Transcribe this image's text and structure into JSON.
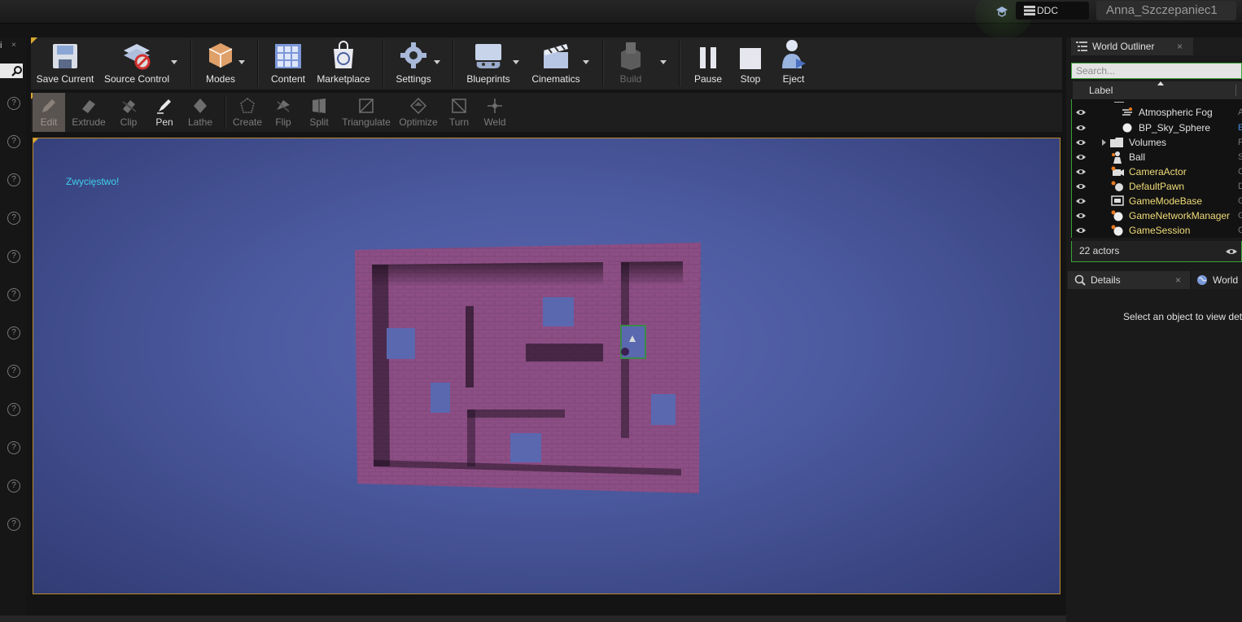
{
  "titlebar": {
    "ddc_label": "DDC",
    "user_name": "Anna_Szczepaniec1"
  },
  "left_strip": {
    "tab_label": "i",
    "close": "×"
  },
  "main_toolbar": {
    "buttons": [
      {
        "label": "Save Current",
        "icon": "save-icon"
      },
      {
        "label": "Source Control",
        "icon": "source-control-icon"
      },
      {
        "label": "Modes",
        "icon": "modes-icon"
      },
      {
        "label": "Content",
        "icon": "content-icon"
      },
      {
        "label": "Marketplace",
        "icon": "marketplace-icon"
      },
      {
        "label": "Settings",
        "icon": "settings-icon"
      },
      {
        "label": "Blueprints",
        "icon": "blueprints-icon"
      },
      {
        "label": "Cinematics",
        "icon": "cinematics-icon"
      },
      {
        "label": "Build",
        "icon": "build-icon"
      },
      {
        "label": "Pause",
        "icon": "pause-icon"
      },
      {
        "label": "Stop",
        "icon": "stop-icon"
      },
      {
        "label": "Eject",
        "icon": "eject-icon"
      }
    ]
  },
  "geometry_toolbar": {
    "tools": [
      "Edit",
      "Extrude",
      "Clip",
      "Pen",
      "Lathe",
      "Create",
      "Flip",
      "Split",
      "Triangulate",
      "Optimize",
      "Turn",
      "Weld"
    ]
  },
  "viewport": {
    "overlay_text": "Zwycięstwo!"
  },
  "world_outliner": {
    "title": "World Outliner",
    "close": "×",
    "search_placeholder": "Search...",
    "column_label": "Label",
    "rows": [
      {
        "name": "Atmospheric Fog",
        "type": "A"
      },
      {
        "name": "BP_Sky_Sphere",
        "type": "E"
      },
      {
        "name": "Volumes",
        "type": "F"
      },
      {
        "name": "Ball",
        "type": "S"
      },
      {
        "name": "CameraActor",
        "type": "C"
      },
      {
        "name": "DefaultPawn",
        "type": "D"
      },
      {
        "name": "GameModeBase",
        "type": "G"
      },
      {
        "name": "GameNetworkManager",
        "type": "G"
      },
      {
        "name": "GameSession",
        "type": "G"
      }
    ],
    "actor_count": "22 actors"
  },
  "details": {
    "tab_label": "Details",
    "close": "×",
    "world_tab_label": "World",
    "empty_message": "Select an object to view det"
  },
  "colors": {
    "viewport_bg": "#4c5aa0",
    "maze": "#8c4e85",
    "accent_green": "#3aa23a",
    "viewport_border": "#b88a2c",
    "victory_text": "#3fd0ee",
    "outliner_yellow": "#f0dc78"
  }
}
